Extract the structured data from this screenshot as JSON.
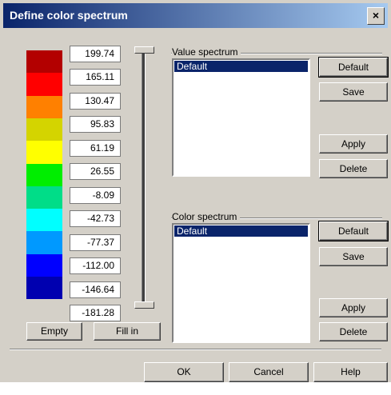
{
  "window": {
    "title": "Define color spectrum",
    "close_label": "×"
  },
  "spectrum": {
    "colors": [
      "#b30000",
      "#ff0000",
      "#ff8000",
      "#d4d400",
      "#ffff00",
      "#00ee00",
      "#00dd88",
      "#00ffff",
      "#0099ff",
      "#0000ff",
      "#0000b0"
    ],
    "values": [
      "199.74",
      "165.11",
      "130.47",
      "95.83",
      "61.19",
      "26.55",
      "-8.09",
      "-42.73",
      "-77.37",
      "-112.00",
      "-146.64",
      "-181.28"
    ]
  },
  "left_buttons": {
    "empty": "Empty",
    "fill_in": "Fill in"
  },
  "value_spectrum": {
    "label": "Value spectrum",
    "items": [
      "Default"
    ],
    "buttons": {
      "default": "Default",
      "save": "Save",
      "apply": "Apply",
      "delete": "Delete"
    }
  },
  "color_spectrum": {
    "label": "Color spectrum",
    "items": [
      "Default"
    ],
    "buttons": {
      "default": "Default",
      "save": "Save",
      "apply": "Apply",
      "delete": "Delete"
    }
  },
  "footer": {
    "ok": "OK",
    "cancel": "Cancel",
    "help": "Help"
  }
}
